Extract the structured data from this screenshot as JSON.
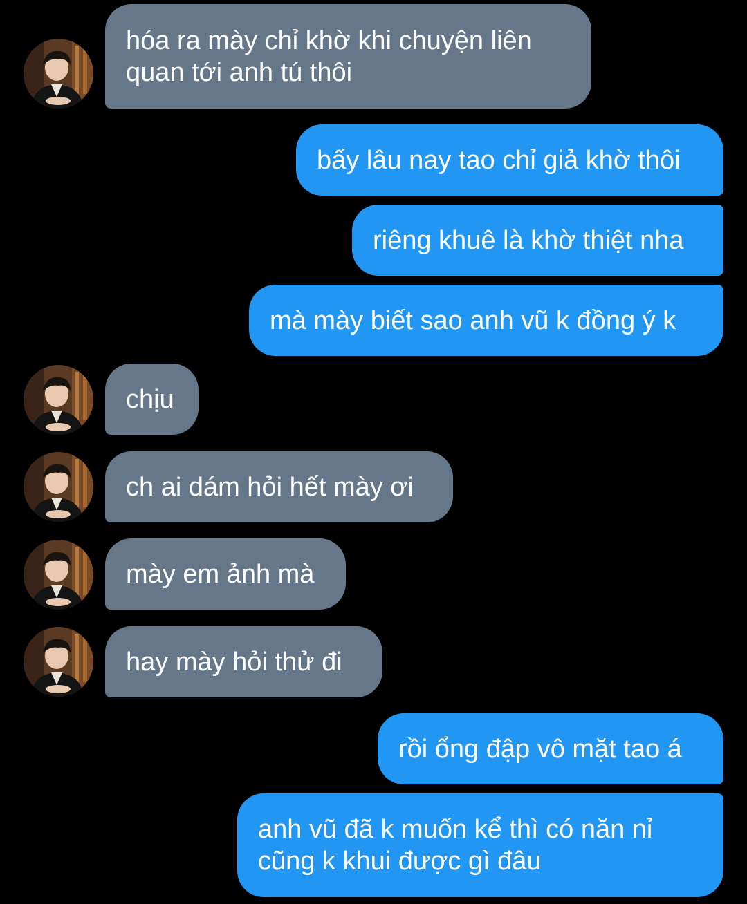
{
  "conversation": {
    "messages": [
      {
        "id": "m1",
        "text": "hóa ra mày chỉ khờ khi chuyện liên\nquan tới anh tú thôi"
      },
      {
        "id": "m2",
        "text": "bấy lâu nay tao chỉ giả khờ thôi"
      },
      {
        "id": "m3",
        "text": "riêng khuê là khờ thiệt nha"
      },
      {
        "id": "m4",
        "text": "mà mày biết sao anh vũ k đồng ý k"
      },
      {
        "id": "m5",
        "text": "chịu"
      },
      {
        "id": "m6",
        "text": "ch ai dám hỏi hết mày ơi"
      },
      {
        "id": "m7",
        "text": "mày em ảnh mà"
      },
      {
        "id": "m8",
        "text": "hay mày hỏi thử đi"
      },
      {
        "id": "m9",
        "text": "rồi ổng đập vô mặt tao á"
      },
      {
        "id": "m10",
        "text": "anh vũ đã k muốn kể thì có năn nỉ\ncũng k khui được gì đâu"
      }
    ]
  },
  "colors": {
    "background": "#000000",
    "incoming_bubble": "#66778a",
    "outgoing_bubble": "#2196f3",
    "text": "#ffffff"
  },
  "icons": {
    "avatar": "profile-photo"
  }
}
